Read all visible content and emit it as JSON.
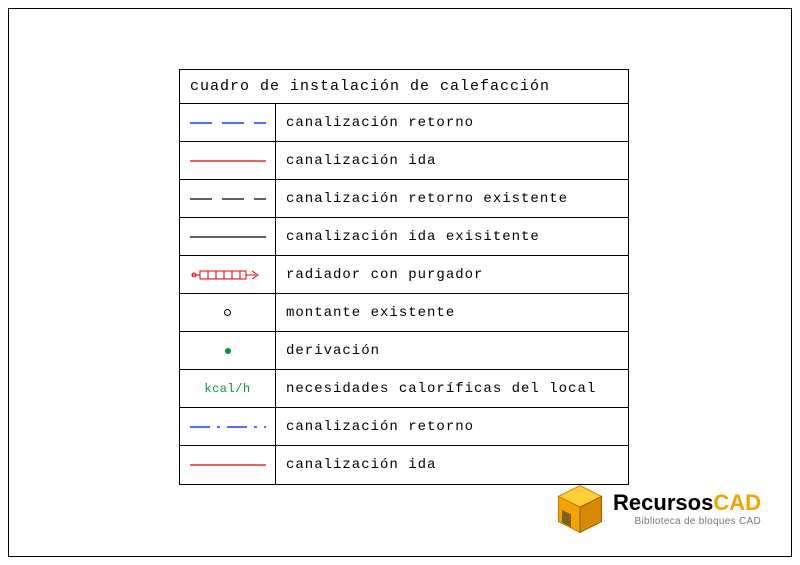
{
  "legend": {
    "title": "cuadro de instalación de calefacción",
    "rows": [
      {
        "symbol": "dash-blue",
        "label": "canalización retorno"
      },
      {
        "symbol": "solid-red",
        "label": "canalización ida"
      },
      {
        "symbol": "dash-black",
        "label": "canalización retorno existente"
      },
      {
        "symbol": "solid-black",
        "label": "canalización ida exisitente"
      },
      {
        "symbol": "radiator",
        "label": "radiador con purgador"
      },
      {
        "symbol": "circle",
        "label": "montante existente"
      },
      {
        "symbol": "dot-green",
        "label": "derivación"
      },
      {
        "symbol": "kcal",
        "kcal_text": "kcal/h",
        "label": "necesidades caloríficas del local"
      },
      {
        "symbol": "dashdot-blue",
        "label": "canalización retorno"
      },
      {
        "symbol": "solid-red",
        "label": "canalización ida"
      }
    ]
  },
  "logo": {
    "brand_prefix": "Recursos",
    "brand_suffix": "CAD",
    "tagline": "Biblioteca de bloques CAD"
  },
  "colors": {
    "blue": "#1a3cff",
    "red": "#e60000",
    "green": "#009933",
    "black": "#000000",
    "orange": "#f5a300",
    "orange_dark": "#b87500"
  }
}
